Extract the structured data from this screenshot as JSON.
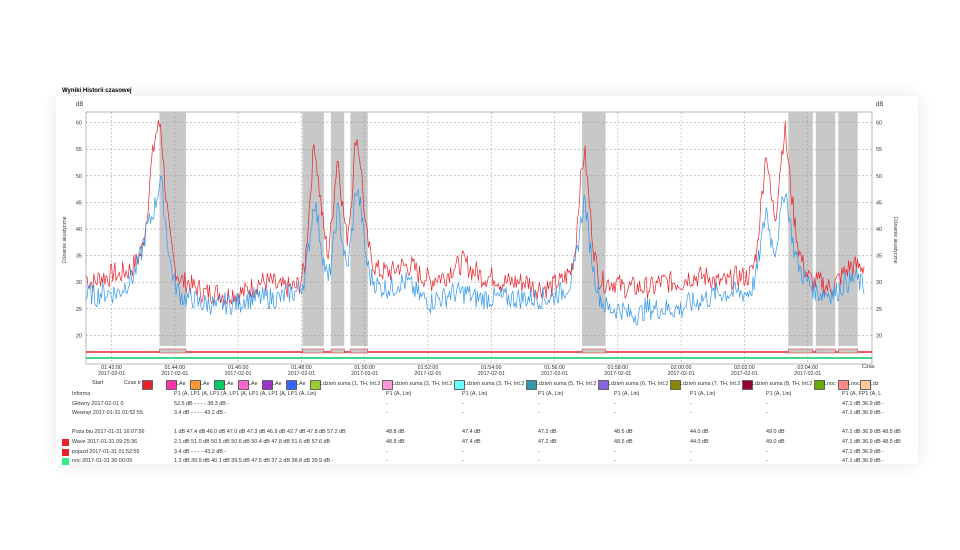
{
  "panel_title": "Wyniki Historii czasowej",
  "chart_data": {
    "type": "line",
    "title": "",
    "ylabel": "Ciśnienie akustyczne",
    "ylabel_right": "Ciśnienie akustyczne",
    "unit_top_left": "dB",
    "unit_top_right": "dB",
    "xlabel": "Czas",
    "ylim": [
      18,
      62
    ],
    "yticks": [
      20,
      25,
      30,
      35,
      40,
      45,
      50,
      55,
      60
    ],
    "xlim_minutes": [
      0,
      25.5
    ],
    "xticks": [
      {
        "time": "01:42:00",
        "date": "2017-02-01"
      },
      {
        "time": "01:44:00",
        "date": "2017-02-01"
      },
      {
        "time": "01:46:00",
        "date": "2017-02-01"
      },
      {
        "time": "01:48:00",
        "date": "2017-02-01"
      },
      {
        "time": "01:50:00",
        "date": "2017-02-01"
      },
      {
        "time": "01:52:00",
        "date": "2017-02-01"
      },
      {
        "time": "01:54:00",
        "date": "2017-02-01"
      },
      {
        "time": "01:56:00",
        "date": "2017-02-01"
      },
      {
        "time": "01:58:00",
        "date": "2017-02-01"
      },
      {
        "time": "02:00:00",
        "date": "2017-02-01"
      },
      {
        "time": "02:02:00",
        "date": "2017-02-01"
      },
      {
        "time": "02:04:00",
        "date": "2017-02-01"
      }
    ],
    "grid": true,
    "events_minutes": [
      [
        3.6,
        4.9
      ],
      [
        10.6,
        11.65
      ],
      [
        12.0,
        12.65
      ],
      [
        12.95,
        13.8
      ],
      [
        24.3,
        25.45
      ],
      [
        34.4,
        35.6
      ],
      [
        35.75,
        36.7
      ],
      [
        36.85,
        37.8
      ]
    ],
    "series": [
      {
        "name": "",
        "color": "#e8232b",
        "base": [
          31,
          30,
          30,
          31,
          31,
          31,
          32,
          31,
          32,
          32,
          33,
          34,
          36,
          42,
          52,
          58,
          60,
          48,
          38,
          33,
          31,
          30,
          30,
          29,
          29,
          28,
          28,
          28,
          28,
          28,
          27,
          28,
          28,
          28,
          28,
          29,
          29,
          30,
          30,
          30,
          30,
          29,
          29,
          29,
          29,
          29,
          30,
          33,
          45,
          57,
          48,
          40,
          35,
          44,
          54,
          45,
          38,
          46,
          58,
          52,
          40,
          35,
          33,
          32,
          32,
          32,
          32,
          33,
          33,
          33,
          33,
          32,
          31,
          31,
          30,
          31,
          31,
          31,
          32,
          33,
          33,
          34,
          33,
          32,
          32,
          31,
          31,
          31,
          31,
          30,
          30,
          30,
          30,
          30,
          30,
          30,
          29,
          29,
          29,
          29,
          29,
          30,
          30,
          31,
          32,
          36,
          48,
          55,
          45,
          36,
          31,
          30,
          30,
          30,
          30,
          29,
          29,
          29,
          29,
          29,
          29,
          29,
          29,
          30,
          30,
          30,
          30,
          30,
          30,
          31,
          31,
          31,
          31,
          31,
          31,
          30,
          30,
          30,
          30,
          31,
          31,
          31,
          31,
          32,
          36,
          46,
          55,
          46,
          42,
          52,
          59,
          50,
          42,
          36,
          33,
          31,
          30,
          30,
          30,
          29,
          29,
          30,
          31,
          32,
          33,
          33,
          33,
          33
        ],
        "step_seconds": 10
      },
      {
        "name": "",
        "color": "#3399ee",
        "base": [
          27,
          28,
          27,
          28,
          28,
          28,
          28,
          28,
          29,
          30,
          31,
          33,
          36,
          40,
          42,
          45,
          50,
          42,
          34,
          30,
          28,
          27,
          27,
          27,
          26,
          26,
          26,
          26,
          25,
          26,
          26,
          26,
          26,
          26,
          27,
          27,
          27,
          27,
          27,
          27,
          27,
          27,
          27,
          28,
          28,
          28,
          29,
          31,
          38,
          46,
          40,
          34,
          30,
          36,
          44,
          38,
          32,
          39,
          48,
          44,
          35,
          31,
          30,
          29,
          29,
          29,
          29,
          30,
          30,
          30,
          29,
          28,
          27,
          27,
          26,
          27,
          27,
          27,
          28,
          28,
          28,
          28,
          28,
          27,
          27,
          27,
          27,
          27,
          27,
          27,
          27,
          27,
          27,
          27,
          27,
          27,
          27,
          27,
          27,
          27,
          27,
          28,
          28,
          29,
          30,
          33,
          40,
          46,
          38,
          32,
          28,
          26,
          25,
          25,
          25,
          25,
          24,
          24,
          24,
          24,
          25,
          25,
          25,
          25,
          25,
          25,
          25,
          25,
          25,
          26,
          26,
          26,
          27,
          27,
          27,
          28,
          28,
          28,
          28,
          28,
          28,
          28,
          28,
          29,
          32,
          38,
          44,
          38,
          36,
          42,
          48,
          42,
          36,
          33,
          31,
          30,
          29,
          28,
          28,
          28,
          28,
          28,
          29,
          30,
          30,
          31,
          30,
          29
        ],
        "step_seconds": 10
      }
    ],
    "track_colors": [
      "#e8232b",
      "#00cc66"
    ]
  },
  "table": {
    "header_start": "Start",
    "header_czas": "Czas tr",
    "legend": [
      {
        "color": "#e8232b",
        "label": ""
      },
      {
        "color": "#ff33aa",
        "label": "LAe"
      },
      {
        "color": "#ff9933",
        "label": "LAe"
      },
      {
        "color": "#00cc66",
        "label": "LAe"
      },
      {
        "color": "#ff66cc",
        "label": "LAe"
      },
      {
        "color": "#9933cc",
        "label": "LAe"
      },
      {
        "color": "#3366ff",
        "label": "LAe"
      },
      {
        "color": "#99cc33",
        "label": "Ldzień suma (1, TH, Int.2"
      },
      {
        "color": "#ff99dd",
        "label": "Ldzień suma (2, TH, Int.2"
      },
      {
        "color": "#66ffff",
        "label": "Ldzień suma (3, TH, Int.2"
      },
      {
        "color": "#3399aa",
        "label": "Ldzień suma (5, TH, Int.2"
      },
      {
        "color": "#8866dd",
        "label": "Ldzień suma (6, TH, Int.2"
      },
      {
        "color": "#888800",
        "label": "Ldzień suma (7, TH, Int.2"
      },
      {
        "color": "#990033",
        "label": "Ldzień suma (8, TH, Int.2"
      },
      {
        "color": "#66aa00",
        "label": "Lnoc"
      },
      {
        "color": "#ff8888",
        "label": "Lnoc"
      },
      {
        "color": "#ffcc99",
        "label": "Ldz"
      }
    ],
    "rows": [
      {
        "swatch": "",
        "label": "Informa",
        "a": "P1 (A, LP1 (A, LP1 (A, LP1 (A, LP1 (A, LP1 (A, LP1 (A, Lin)",
        "cols": [
          "P1 (A, Lin)",
          "P1 (A, Lin)",
          "P1 (A, Lin)",
          "P1 (A, Lin)",
          "P1 (A, Lin)",
          "P1 (A, Lin)",
          "P1 (A, FP1 (A, L"
        ]
      },
      {
        "swatch": "",
        "label": "Główny 2017-02-01 0",
        "a": "52.5 dB -        -        -        -    38.3 dB -",
        "cols": [
          "-",
          "-",
          "-",
          "-",
          "-",
          "-",
          "47.1 dB 36.9 dB -"
        ]
      },
      {
        "swatch": "",
        "label": "Wewnęt 2017-01-31 01:52:55",
        "a": "3.4 dB -        -        -        -    43.2 dB -",
        "cols": [
          "-",
          "-",
          "-",
          "-",
          "-",
          "-",
          "47.1 dB 36.9 dB -"
        ]
      },
      {
        "swatch": "",
        "label": "",
        "a": "",
        "cols": [
          "",
          "",
          "",
          "",
          "",
          "",
          ""
        ]
      },
      {
        "swatch": "",
        "label": "Poza biu 2017-01-31 16:07:56",
        "a": "1 dB 47.4 dB 46.0 dB 47.0 dB 47.3 dB 46.9 dB 42.7 dB 47.8 dB 57.2 dB",
        "cols": [
          "48.8 dB",
          "47.4 dB",
          "47.2 dB",
          "48.5 dB",
          "44.0 dB",
          "49.0 dB",
          "47.1 dB 36.9 dB 48.5 dB"
        ]
      },
      {
        "swatch": "#e8232b",
        "label": "Wave 2017-01-31 09:25:36",
        "a": "2.1 dB 51.0 dB 50.5 dB 50.6 dB 50.4 dB 47.8 dB 51.6 dB 57.6 dB",
        "cols": [
          "48.8 dB",
          "47.4 dB",
          "47.2 dB",
          "48.5 dB",
          "44.0 dB",
          "49.0 dB",
          "47.1 dB 36.9 dB 48.5 dB"
        ]
      },
      {
        "swatch": "#e8232b",
        "label": "pojazd 2017-01-31 01:52:55",
        "a": "3.4 dB -        -        -        -    43.2 dB -",
        "cols": [
          "-",
          "-",
          "-",
          "-",
          "-",
          "-",
          "47.1 dB 36.9 dB -"
        ]
      },
      {
        "swatch": "#33ee88",
        "label": "noc 2017-01-31 36:00:05",
        "a": "1.3 dB 39.9 dB 40.1 dB 39.5 dB 47.5 dB 37.2 dB 38.8 dB 39.9 dB -",
        "cols": [
          "-",
          "-",
          "-",
          "-",
          "-",
          "-",
          "47.1 dB 36.9 dB -"
        ]
      }
    ]
  }
}
